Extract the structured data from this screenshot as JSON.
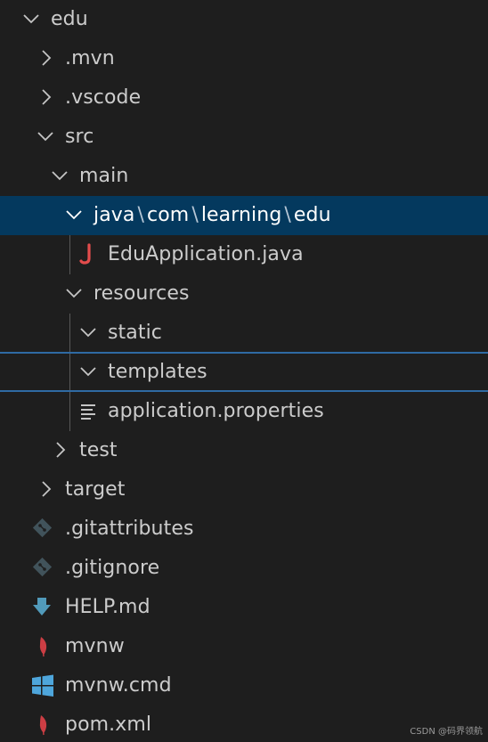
{
  "tree": {
    "edu": "edu",
    "mvn": ".mvn",
    "vscode": ".vscode",
    "src": "src",
    "main": "main",
    "java_path": {
      "java": "java",
      "com": "com",
      "learning": "learning",
      "edu": "edu",
      "separator": "\\"
    },
    "edu_application": "EduApplication.java",
    "resources": "resources",
    "static": "static",
    "templates": "templates",
    "application_properties": "application.properties",
    "test": "test",
    "target": "target",
    "gitattributes": ".gitattributes",
    "gitignore": ".gitignore",
    "help_md": "HELP.md",
    "mvnw": "mvnw",
    "mvnw_cmd": "mvnw.cmd",
    "pom_xml": "pom.xml"
  },
  "icons": {
    "chevron_down": "chevron-down-icon",
    "chevron_right": "chevron-right-icon",
    "java": "java-file-icon",
    "properties": "properties-file-icon",
    "git": "git-file-icon",
    "markdown": "markdown-download-icon",
    "maven": "maven-feather-icon",
    "windows": "windows-icon"
  },
  "colors": {
    "background": "#1e1e1e",
    "selected_row": "#04395e",
    "focus_border": "#2f6aa3",
    "java_icon": "#e34c4c",
    "git_icon": "#41535b",
    "markdown_icon": "#519aba",
    "maven_icon": "#cc3e44",
    "windows_icon": "#4ea6dc"
  },
  "watermark": "CSDN @码界领航"
}
